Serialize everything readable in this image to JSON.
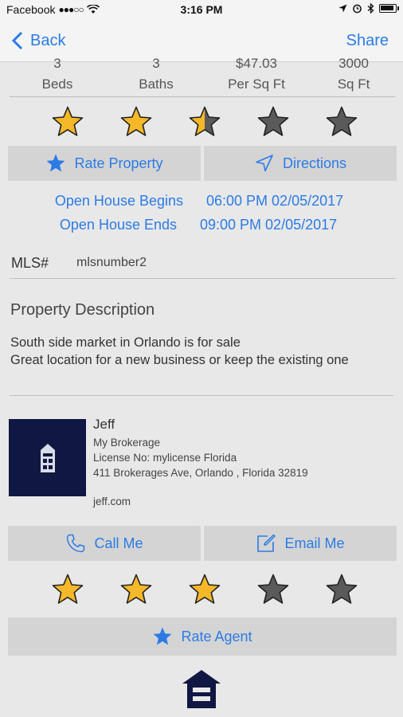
{
  "status_bar": {
    "carrier": "Facebook",
    "signal": "●●●○○",
    "time": "3:16 PM",
    "battery_level": 0.95
  },
  "nav": {
    "back_label": "Back",
    "share_label": "Share"
  },
  "stats": [
    {
      "value": "3",
      "label": "Beds"
    },
    {
      "value": "3",
      "label": "Baths"
    },
    {
      "value": "$47.03",
      "label": "Per Sq Ft"
    },
    {
      "value": "3000",
      "label": "Sq Ft"
    }
  ],
  "property_rating": {
    "filled": 2.5,
    "max": 5
  },
  "property_buttons": {
    "rate_label": "Rate Property",
    "directions_label": "Directions"
  },
  "open_house": {
    "begins_label": "Open House Begins",
    "begins_value": "06:00 PM 02/05/2017",
    "ends_label": "Open House Ends",
    "ends_value": "09:00 PM 02/05/2017"
  },
  "mls": {
    "label": "MLS#",
    "value": "mlsnumber2"
  },
  "description": {
    "title": "Property Description",
    "line1": "South side market in Orlando is for sale",
    "line2": "Great location for a new business or keep the existing one"
  },
  "agent": {
    "name": "Jeff",
    "brokerage": "My Brokerage",
    "license": "License No: mylicense   Florida",
    "address": "411 Brokerages Ave, Orlando , Florida  32819",
    "website": "jeff.com"
  },
  "agent_buttons": {
    "call_label": "Call Me",
    "email_label": "Email Me"
  },
  "agent_rating": {
    "filled": 3,
    "max": 5
  },
  "rate_agent_label": "Rate Agent",
  "colors": {
    "accent": "#2c7be5",
    "star_gold": "#f5b829",
    "star_empty": "#5a5a5a",
    "agent_photo_bg": "#0f1742"
  }
}
